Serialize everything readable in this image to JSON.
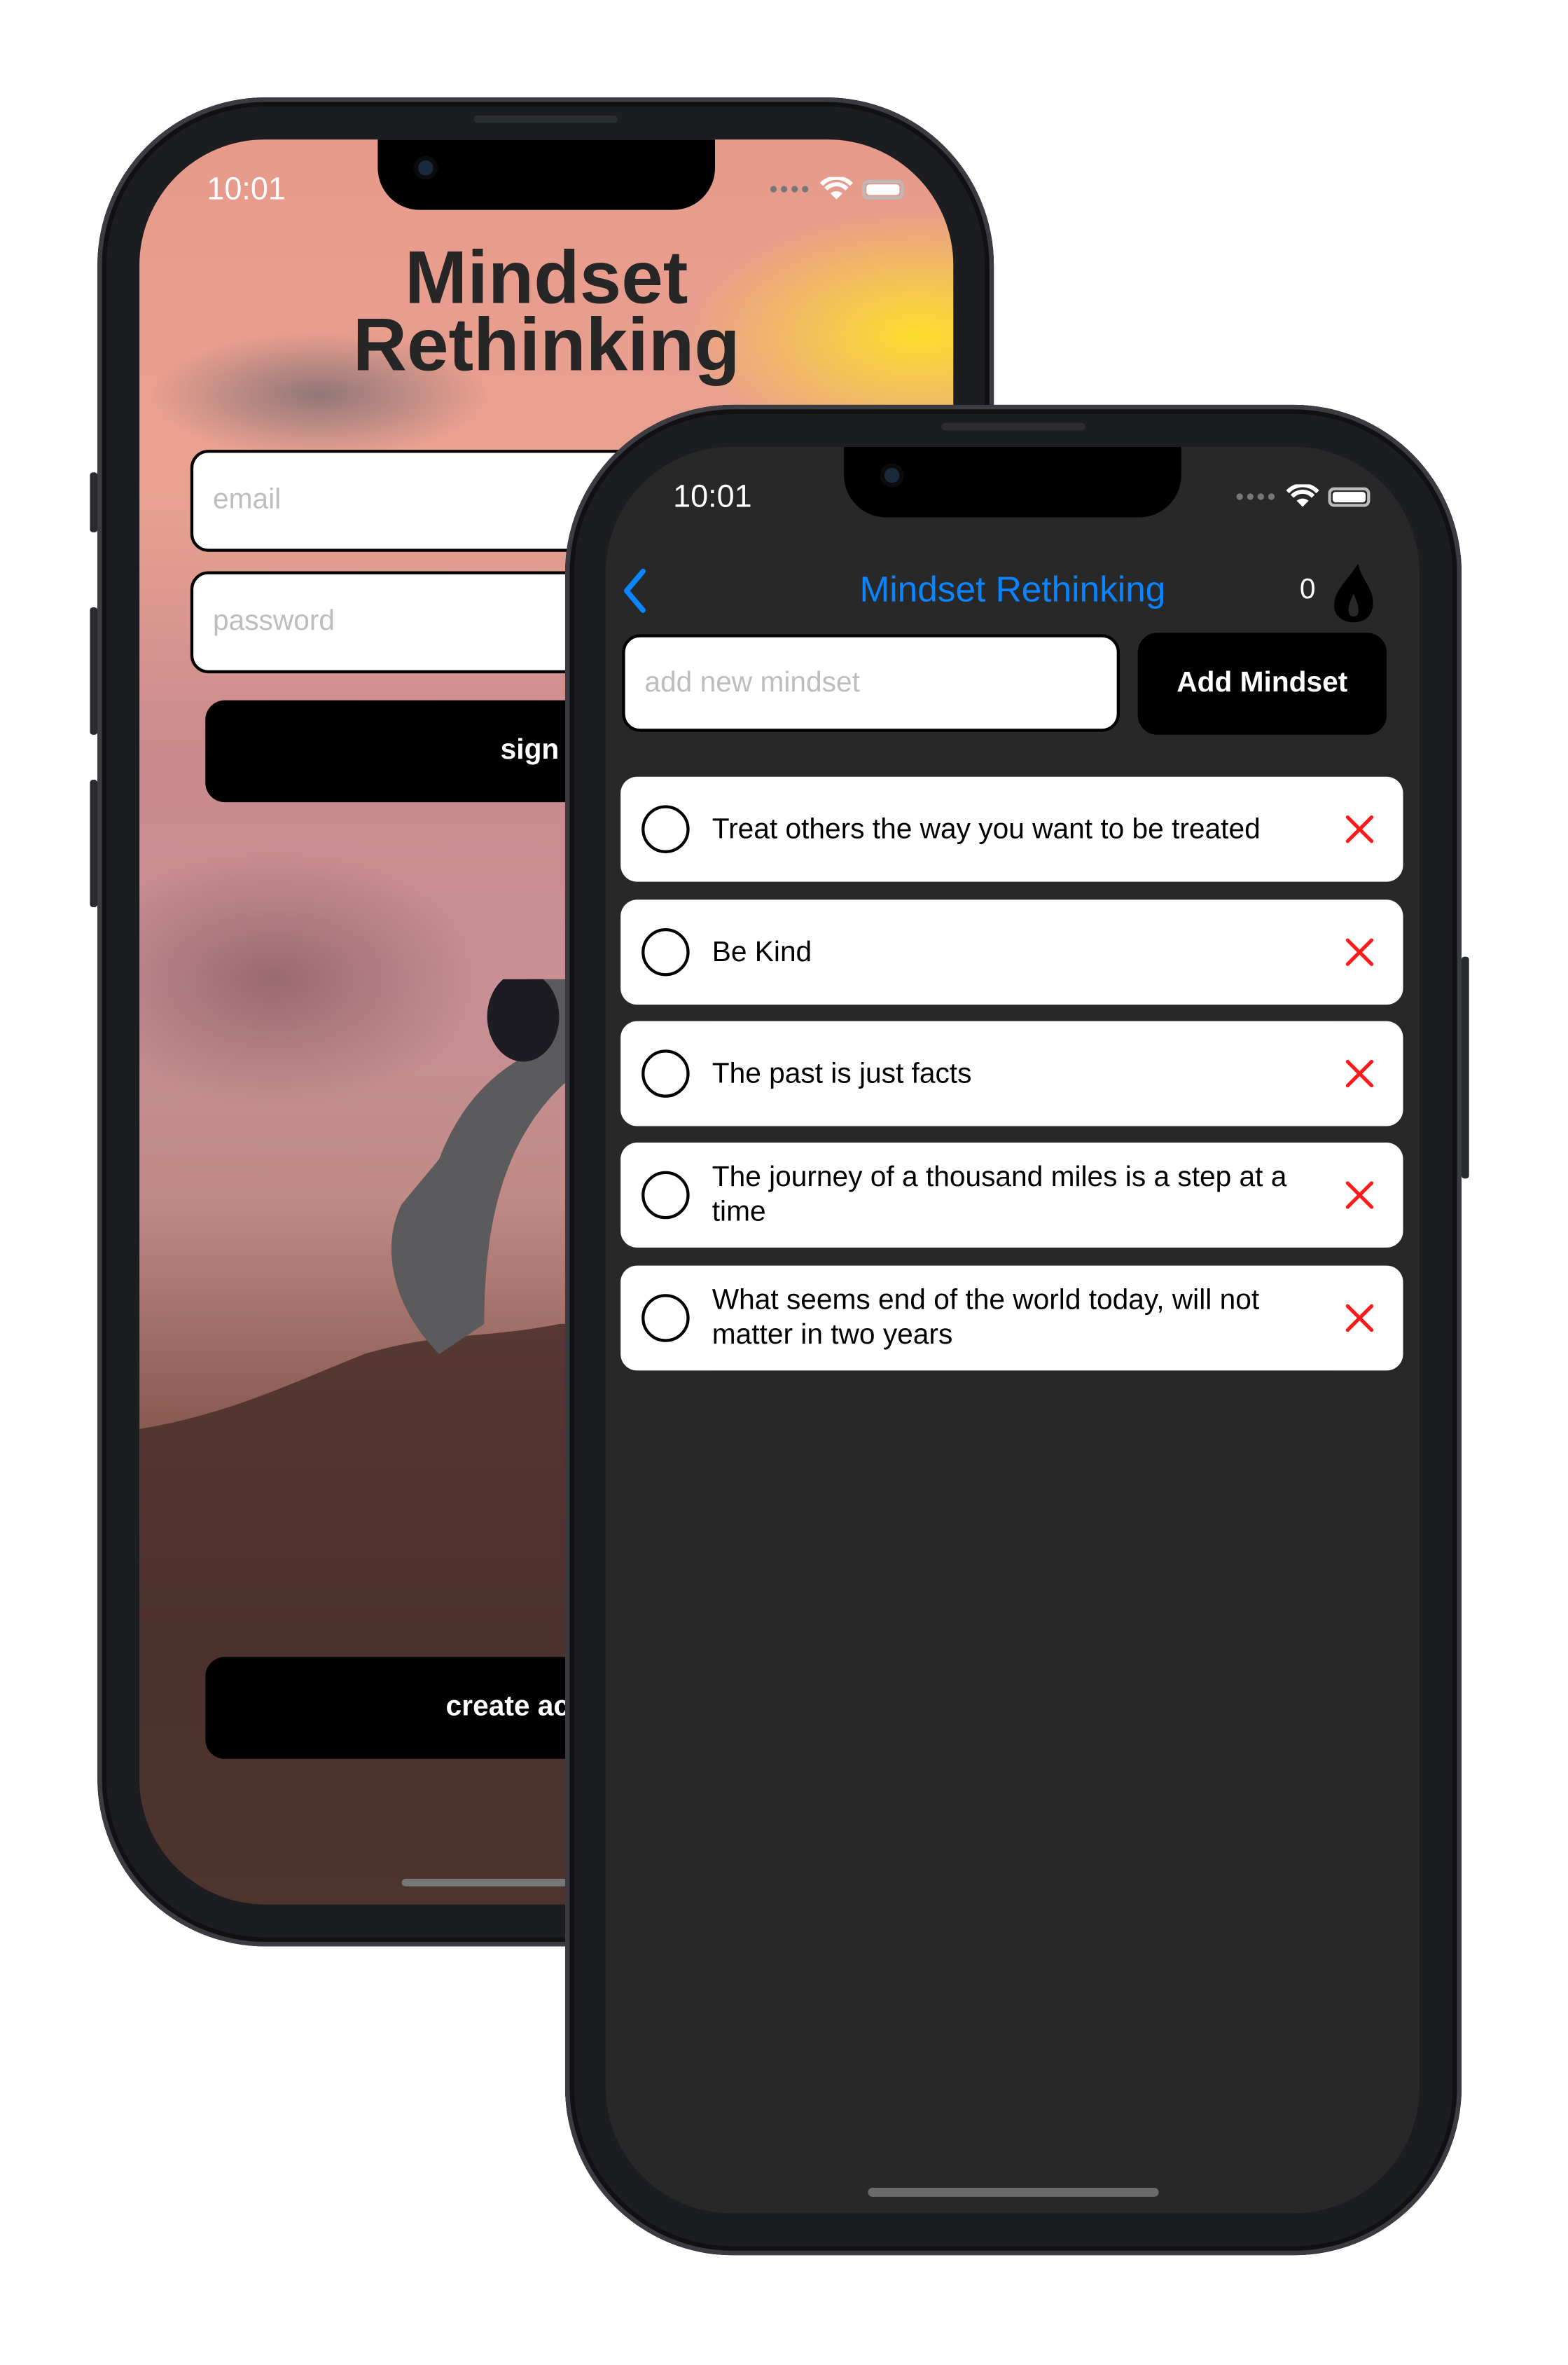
{
  "colors": {
    "accent": "#0a84ff",
    "delete": "#ff1a1a",
    "app_background": "#282828"
  },
  "login_screen": {
    "status_time": "10:01",
    "title_line1": "Mindset",
    "title_line2": "Rethinking",
    "email_placeholder": "email",
    "password_placeholder": "password",
    "sign_in_label": "sign in",
    "create_account_label": "create account"
  },
  "list_screen": {
    "status_time": "10:01",
    "nav": {
      "back_icon": "chevron-left-icon",
      "title": "Mindset Rethinking",
      "streak_count": "0",
      "streak_icon": "flame-icon"
    },
    "input_placeholder": "add new mindset",
    "add_button_label": "Add Mindset",
    "items": [
      {
        "text": "Treat others the way you want to be treated",
        "done": false
      },
      {
        "text": "Be Kind",
        "done": false
      },
      {
        "text": "The past is just facts",
        "done": false
      },
      {
        "text": "The journey of a thousand miles is a step at a time",
        "done": false
      },
      {
        "text": "What seems end of the world today, will not matter in two years",
        "done": false
      }
    ]
  }
}
